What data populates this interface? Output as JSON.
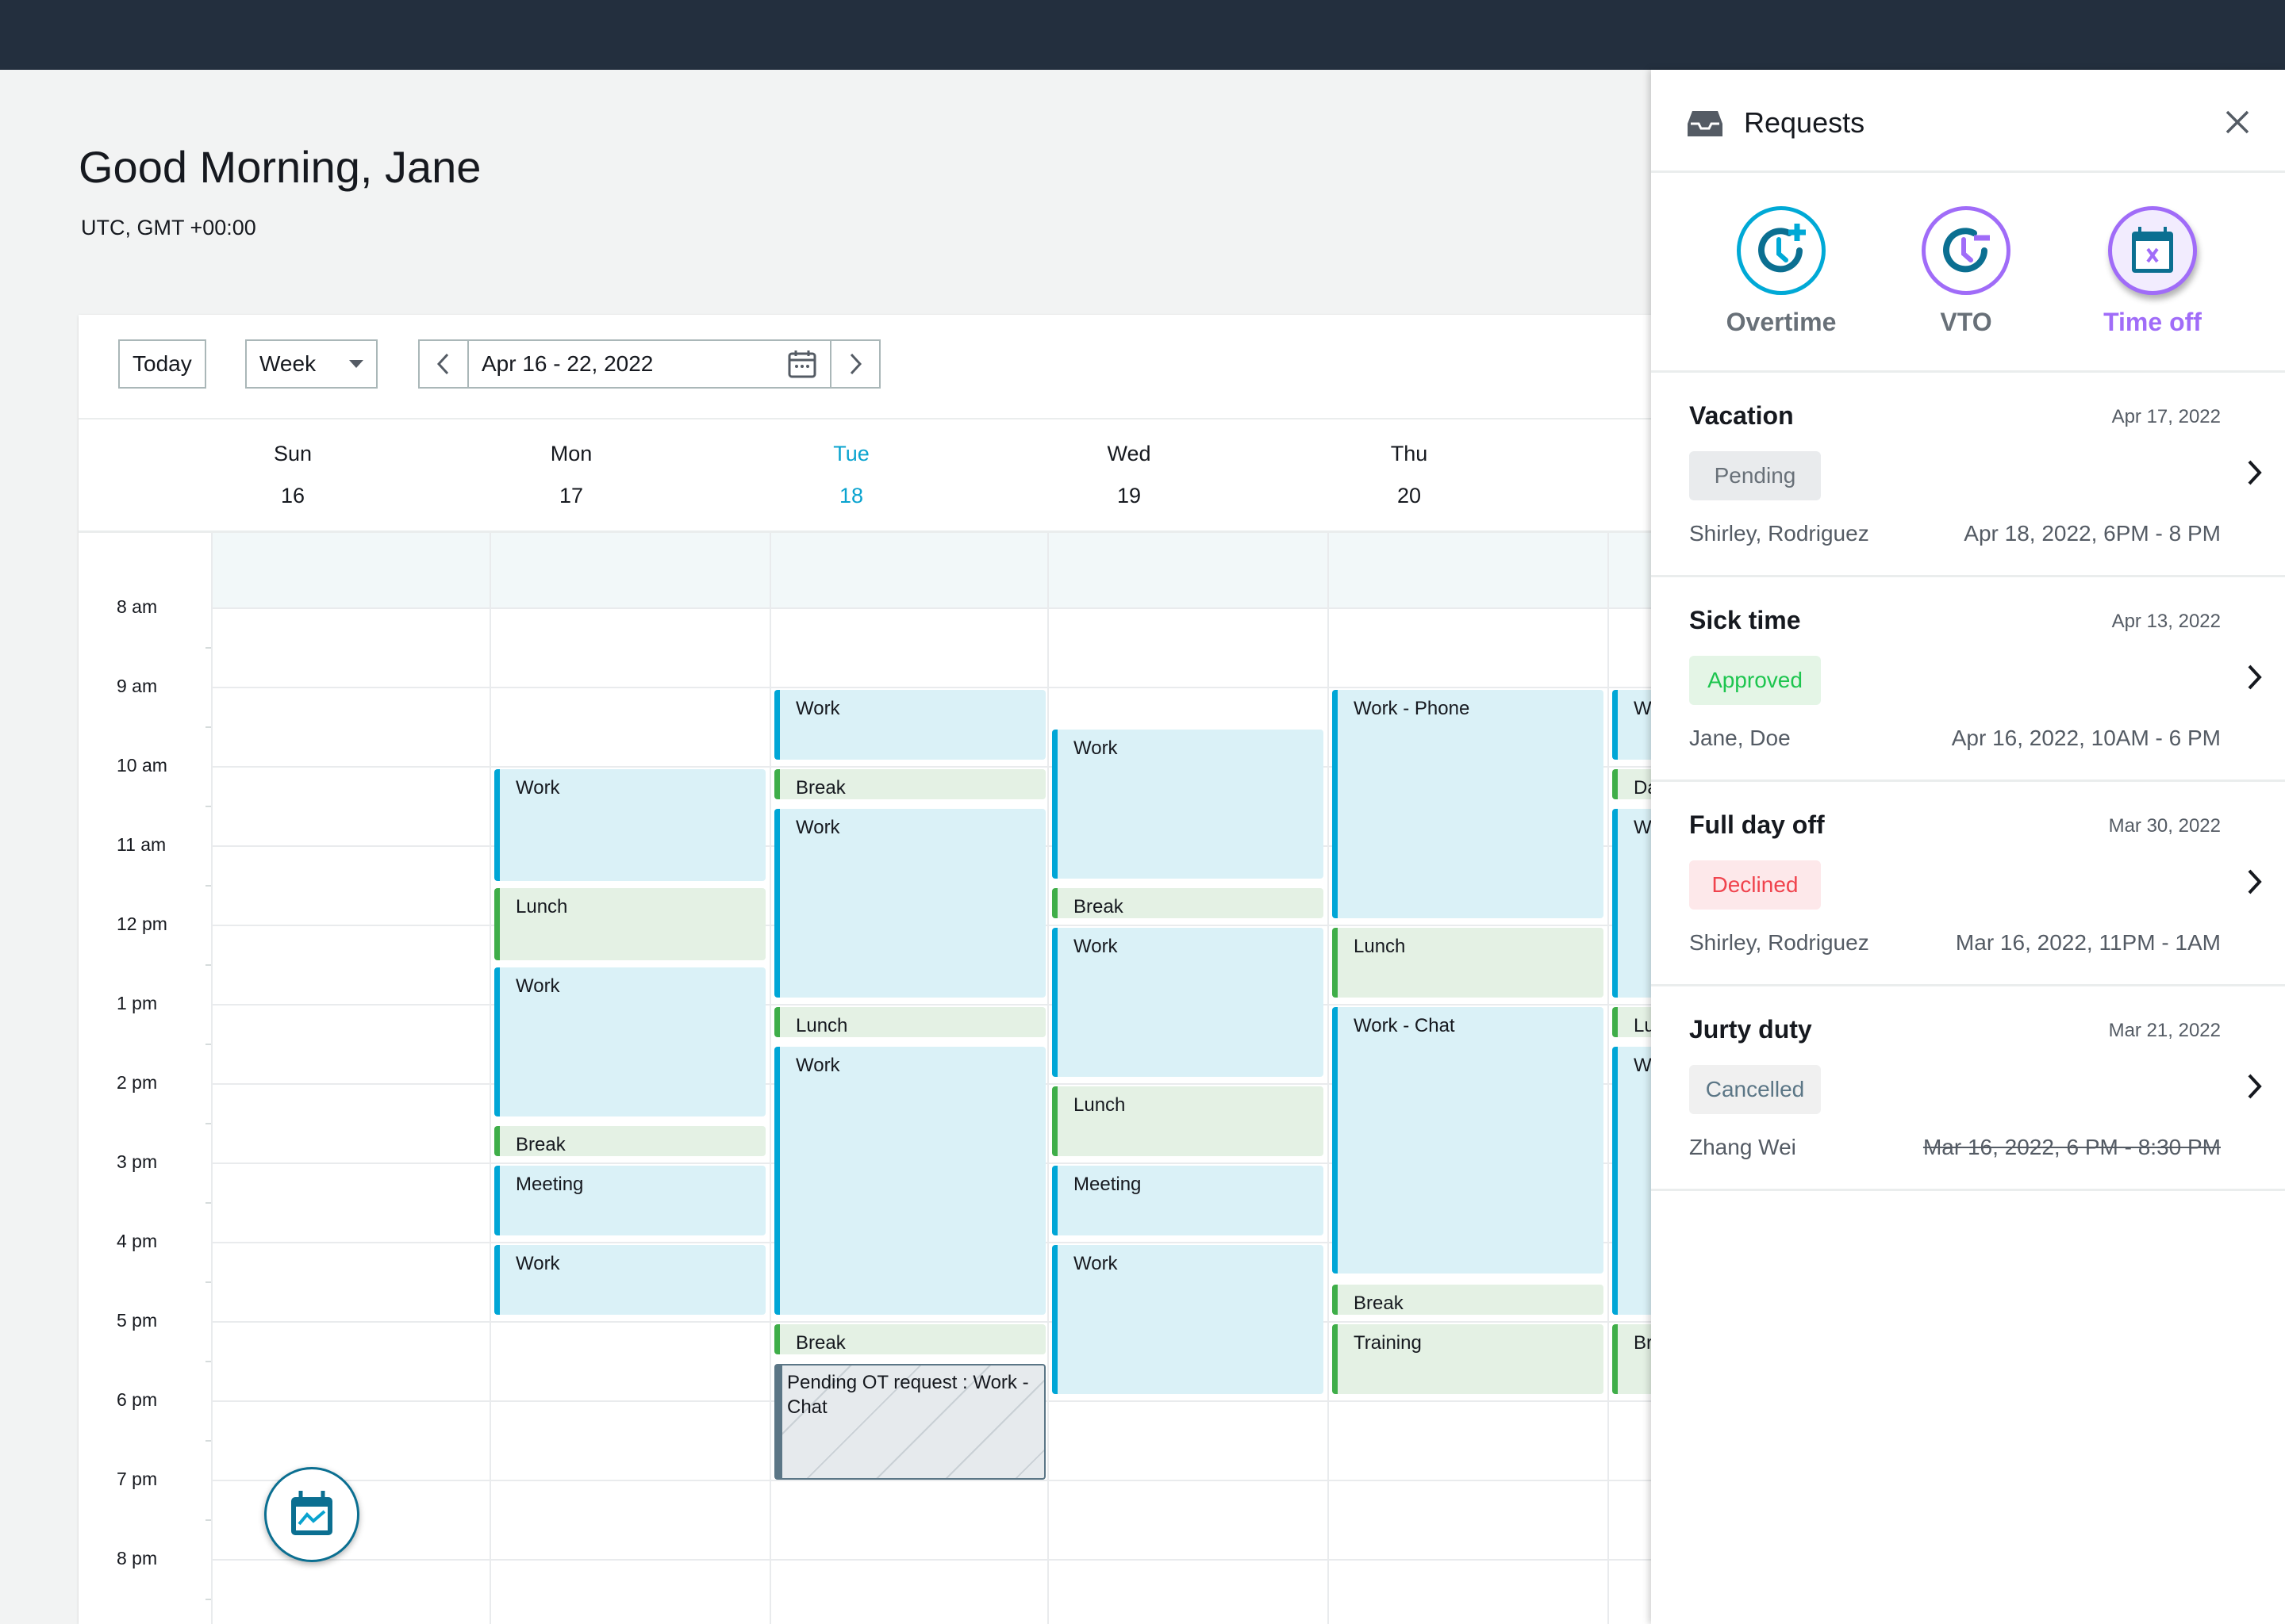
{
  "greeting": "Good Morning, Jane",
  "timezone": "UTC, GMT +00:00",
  "toolbar": {
    "today": "Today",
    "view": "Week",
    "range": "Apr 16 - 22, 2022"
  },
  "days": [
    {
      "name": "Sun",
      "num": "16",
      "today": false,
      "events": []
    },
    {
      "name": "Mon",
      "num": "17",
      "today": false,
      "events": [
        {
          "label": "Work",
          "type": "work",
          "start": 10,
          "end": 11.45
        },
        {
          "label": "Lunch",
          "type": "break",
          "start": 11.5,
          "end": 12.45
        },
        {
          "label": "Work",
          "type": "work",
          "start": 12.5,
          "end": 14.42
        },
        {
          "label": "Break",
          "type": "break",
          "start": 14.5,
          "end": 14.92
        },
        {
          "label": "Meeting",
          "type": "work",
          "start": 15,
          "end": 15.92
        },
        {
          "label": "Work",
          "type": "work",
          "start": 16,
          "end": 16.92
        }
      ]
    },
    {
      "name": "Tue",
      "num": "18",
      "today": true,
      "events": [
        {
          "label": "Work",
          "type": "work",
          "start": 9,
          "end": 9.92
        },
        {
          "label": "Break",
          "type": "break",
          "start": 10,
          "end": 10.42
        },
        {
          "label": "Work",
          "type": "work",
          "start": 10.5,
          "end": 12.92
        },
        {
          "label": "Lunch",
          "type": "break",
          "start": 13,
          "end": 13.42
        },
        {
          "label": "Work",
          "type": "work",
          "start": 13.5,
          "end": 16.92
        },
        {
          "label": "Break",
          "type": "break",
          "start": 17,
          "end": 17.42
        },
        {
          "label": "Pending OT request : Work - Chat",
          "type": "pending",
          "start": 17.5,
          "end": 19
        }
      ]
    },
    {
      "name": "Wed",
      "num": "19",
      "today": false,
      "events": [
        {
          "label": "Work",
          "type": "work",
          "start": 9.5,
          "end": 11.42
        },
        {
          "label": "Break",
          "type": "break",
          "start": 11.5,
          "end": 11.92
        },
        {
          "label": "Work",
          "type": "work",
          "start": 12,
          "end": 13.92
        },
        {
          "label": "Lunch",
          "type": "break",
          "start": 14,
          "end": 14.92
        },
        {
          "label": "Meeting",
          "type": "work",
          "start": 15,
          "end": 15.92
        },
        {
          "label": "Work",
          "type": "work",
          "start": 16,
          "end": 17.92
        }
      ]
    },
    {
      "name": "Thu",
      "num": "20",
      "today": false,
      "events": [
        {
          "label": "Work - Phone",
          "type": "work",
          "start": 9,
          "end": 11.92
        },
        {
          "label": "Lunch",
          "type": "break",
          "start": 12,
          "end": 12.92
        },
        {
          "label": "Work - Chat",
          "type": "work",
          "start": 13,
          "end": 16.4
        },
        {
          "label": "Break",
          "type": "break",
          "start": 16.5,
          "end": 16.92
        },
        {
          "label": "Training",
          "type": "break",
          "start": 17,
          "end": 17.92
        }
      ]
    },
    {
      "name": "",
      "num": "",
      "today": false,
      "events": [
        {
          "label": "Wo",
          "type": "work",
          "start": 9,
          "end": 9.92
        },
        {
          "label": "Da",
          "type": "break",
          "start": 10,
          "end": 10.42
        },
        {
          "label": "Wo",
          "type": "work",
          "start": 10.5,
          "end": 12.92
        },
        {
          "label": "Lu",
          "type": "break",
          "start": 13,
          "end": 13.42
        },
        {
          "label": "Wo",
          "type": "work",
          "start": 13.5,
          "end": 16.92
        },
        {
          "label": "Br",
          "type": "break",
          "start": 17,
          "end": 17.92
        }
      ]
    }
  ],
  "hours": [
    "8 am",
    "9 am",
    "10 am",
    "11 am",
    "12 pm",
    "1 pm",
    "2 pm",
    "3 pm",
    "4 pm",
    "5 pm",
    "6 pm",
    "7 pm",
    "8 pm"
  ],
  "panel": {
    "title": "Requests",
    "tiles": [
      {
        "label": "Overtime",
        "icon": "clock-plus-icon"
      },
      {
        "label": "VTO",
        "icon": "clock-minus-icon"
      },
      {
        "label": "Time off",
        "icon": "calendar-x-icon",
        "selected": true
      }
    ],
    "requests": [
      {
        "title": "Vacation",
        "date": "Apr 17, 2022",
        "status": "Pending",
        "name": "Shirley, Rodriguez",
        "range": "Apr 18, 2022, 6PM - 8 PM"
      },
      {
        "title": "Sick time",
        "date": "Apr 13, 2022",
        "status": "Approved",
        "name": "Jane, Doe",
        "range": "Apr 16, 2022, 10AM - 6 PM"
      },
      {
        "title": "Full day off",
        "date": "Mar 30, 2022",
        "status": "Declined",
        "name": "Shirley, Rodriguez",
        "range": "Mar 16, 2022, 11PM - 1AM"
      },
      {
        "title": "Jurty duty",
        "date": "Mar 21, 2022",
        "status": "Cancelled",
        "name": "Zhang Wei",
        "range": "Mar 16, 2022, 6 PM - 8:30 PM",
        "struck": true
      }
    ]
  },
  "colors": {
    "topbar": "#232f3e",
    "accent": "#0aa3cf",
    "work": "#00a6d6",
    "break": "#3fae49",
    "purple": "#a06cf8"
  }
}
